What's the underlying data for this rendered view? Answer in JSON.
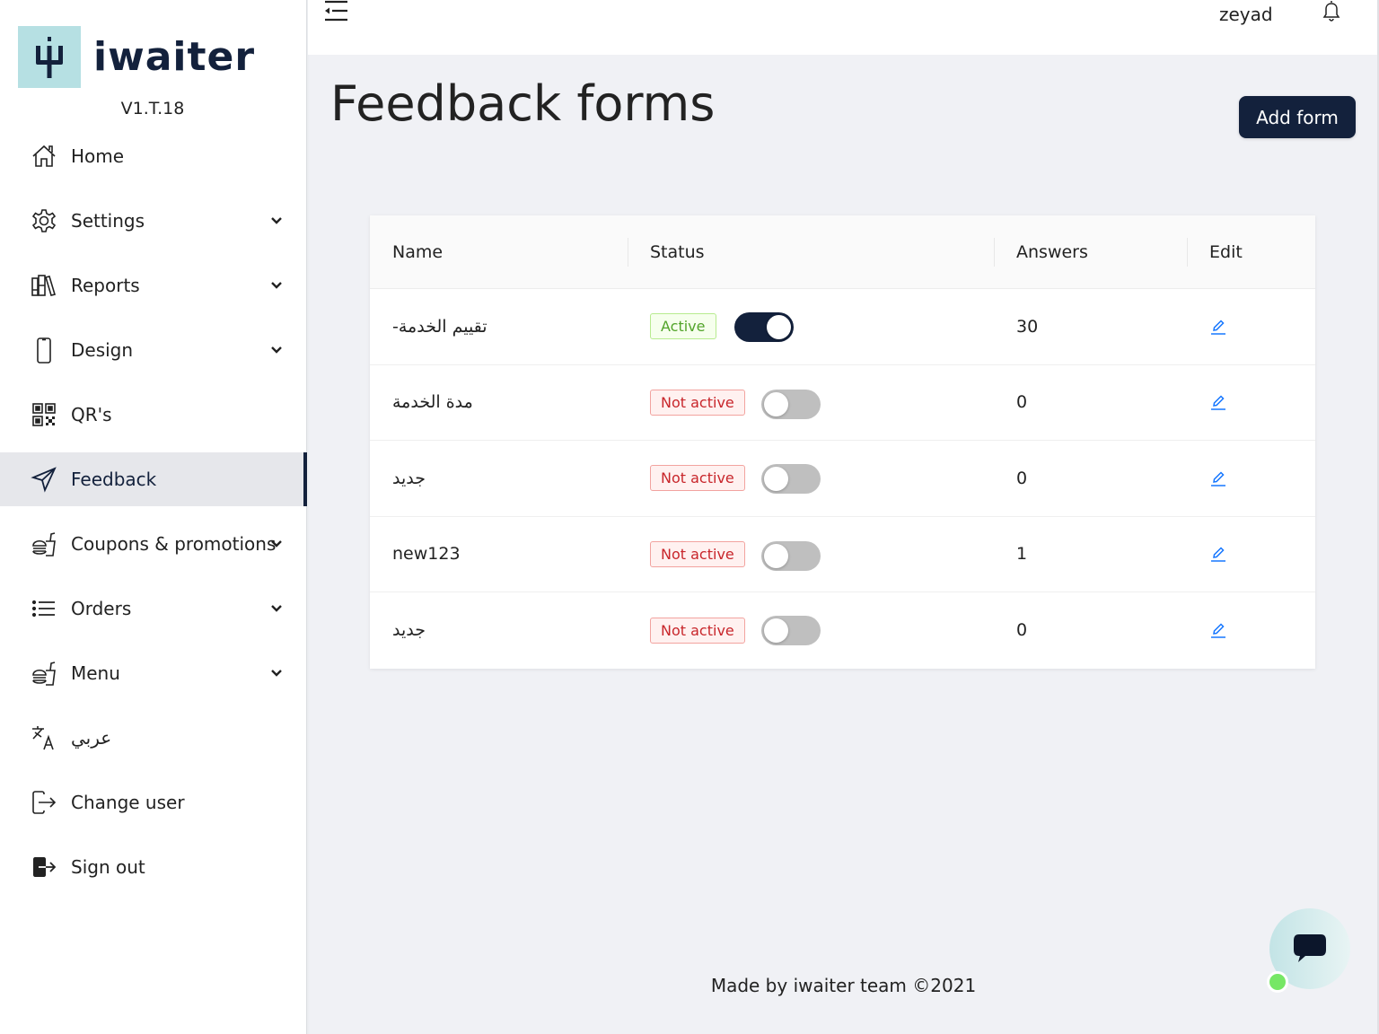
{
  "app": {
    "brand": "iwaiter",
    "version": "V1.T.18"
  },
  "sidebar": {
    "items": [
      {
        "label": "Home",
        "icon": "home-icon",
        "expandable": false,
        "active": false
      },
      {
        "label": "Settings",
        "icon": "gear-icon",
        "expandable": true,
        "active": false
      },
      {
        "label": "Reports",
        "icon": "books-icon",
        "expandable": true,
        "active": false
      },
      {
        "label": "Design",
        "icon": "phone-icon",
        "expandable": true,
        "active": false
      },
      {
        "label": "QR's",
        "icon": "qr-code-icon",
        "expandable": false,
        "active": false
      },
      {
        "label": "Feedback",
        "icon": "send-icon",
        "expandable": false,
        "active": true
      },
      {
        "label": "Coupons & promotions",
        "icon": "fast-food-icon",
        "expandable": true,
        "active": false
      },
      {
        "label": "Orders",
        "icon": "list-icon",
        "expandable": true,
        "active": false
      },
      {
        "label": "Menu",
        "icon": "fast-food-icon",
        "expandable": true,
        "active": false
      },
      {
        "label": "عربي",
        "icon": "translate-icon",
        "expandable": false,
        "active": false
      },
      {
        "label": "Change user",
        "icon": "logout-outline-icon",
        "expandable": false,
        "active": false
      },
      {
        "label": "Sign out",
        "icon": "logout-filled-icon",
        "expandable": false,
        "active": false
      }
    ]
  },
  "topbar": {
    "username": "zeyad",
    "collapse_icon": "menu-fold-icon",
    "notification_icon": "bell-icon"
  },
  "main": {
    "title": "Feedback forms",
    "add_button": "Add form",
    "table": {
      "columns": [
        "Name",
        "Status",
        "Answers",
        "Edit"
      ],
      "rows": [
        {
          "name": "-تقييم الخدمة",
          "status": "Active",
          "enabled": true,
          "answers": "30"
        },
        {
          "name": "مدة الخدمة",
          "status": "Not active",
          "enabled": false,
          "answers": "0"
        },
        {
          "name": "جديد",
          "status": "Not active",
          "enabled": false,
          "answers": "0"
        },
        {
          "name": "new123",
          "status": "Not active",
          "enabled": false,
          "answers": "1"
        },
        {
          "name": "جديد",
          "status": "Not active",
          "enabled": false,
          "answers": "0"
        }
      ]
    }
  },
  "footer": {
    "text": "Made by iwaiter team ©2021"
  },
  "colors": {
    "brand_navy": "#13213c",
    "logo_bg": "#b6e0e3",
    "active_green": "#52a42a",
    "inactive_red": "#c8262b",
    "edit_blue": "#1677ff",
    "online_green": "#76e765"
  }
}
